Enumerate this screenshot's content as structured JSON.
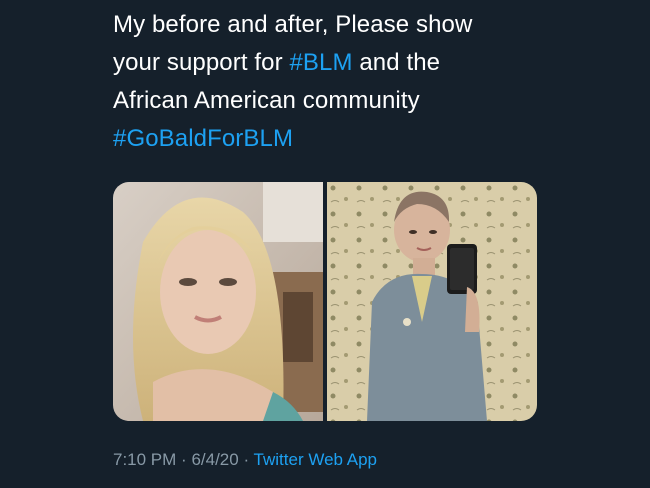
{
  "tweet": {
    "text_lines": [
      [
        {
          "t": "My before and after, Please show"
        }
      ],
      [
        {
          "t": "your support for "
        },
        {
          "t": "#BLM",
          "hashtag": true
        },
        {
          "t": " and the"
        }
      ],
      [
        {
          "t": "African American community"
        }
      ],
      [
        {
          "t": "#GoBaldForBLM",
          "hashtag": true
        }
      ]
    ],
    "media": [
      {
        "name": "before-photo",
        "icon": "photo-blonde-hair-selfie"
      },
      {
        "name": "after-photo",
        "icon": "photo-shaved-head-mirror-selfie"
      }
    ],
    "time": "7:10 PM",
    "separator": "·",
    "date": "6/4/20",
    "source": "Twitter Web App"
  },
  "colors": {
    "background": "#15202b",
    "text": "#ffffff",
    "link": "#1da1f2",
    "secondary": "#8899a6"
  }
}
